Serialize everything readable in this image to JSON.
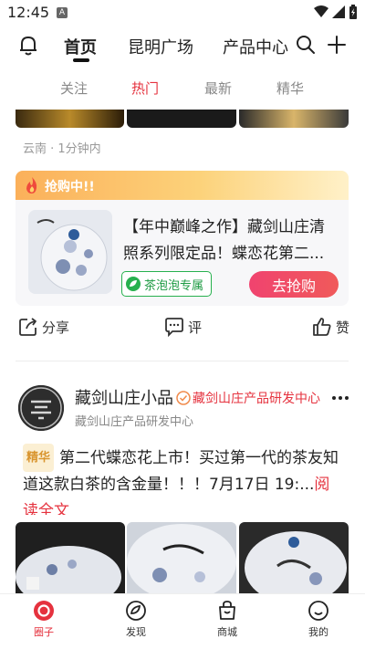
{
  "status_bar": {
    "time": "12:45",
    "badge": "A"
  },
  "top_nav": {
    "tabs": [
      "首页",
      "昆明广场",
      "产品中心"
    ],
    "active_tab": "首页"
  },
  "sub_tabs": {
    "tabs": [
      "关注",
      "热门",
      "最新",
      "精华"
    ],
    "active_tab": "热门"
  },
  "prev_post": {
    "meta": "云南 · 1分钟内",
    "promo": {
      "banner_label": "抢购中!!",
      "title": "【年中巅峰之作】藏剑山庄清照系列限定品！蝶恋花第二...",
      "tag": "茶泡泡专属",
      "buy_label": "去抢购"
    },
    "actions": {
      "share": "分享",
      "comment": "评",
      "like": "赞"
    }
  },
  "post": {
    "author": "藏剑山庄小品",
    "verified_label": "藏剑山庄产品研发中心",
    "sub_name": "藏剑山庄产品研发中心",
    "badge": "精华",
    "body": "第二代蝶恋花上市！买过第一代的茶友知道这款白茶的含金量！！！7月17日 19:...",
    "read_all": "阅读全文"
  },
  "bottom_nav": {
    "items": [
      "圈子",
      "发现",
      "商城",
      "我的"
    ],
    "active": "圈子"
  },
  "colors": {
    "accent": "#e5323e",
    "green": "#27b04e",
    "banner": "#fbb05a"
  }
}
